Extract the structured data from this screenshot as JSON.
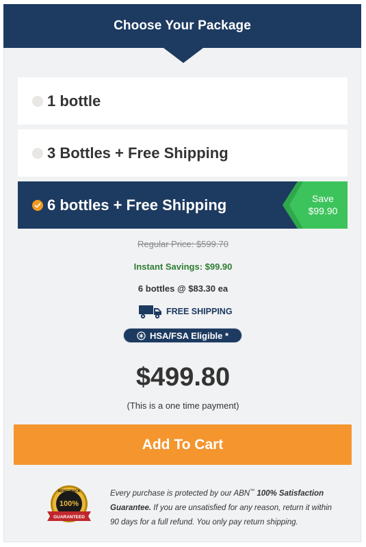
{
  "header": {
    "title": "Choose Your Package"
  },
  "packages": [
    {
      "label": "1 bottle",
      "selected": false
    },
    {
      "label": "3 Bottles + Free Shipping",
      "selected": false
    },
    {
      "label": "6 bottles + Free Shipping",
      "selected": true,
      "save_line1": "Save",
      "save_line2": "$99.90"
    }
  ],
  "details": {
    "regular_price": "Regular Price: $599.70",
    "instant_savings": "Instant Savings: $99.90",
    "per_bottle": "6 bottles @ $83.30 ea",
    "shipping_label": "FREE SHIPPING",
    "hsa_label": "HSA/FSA Eligible *"
  },
  "price": "$499.80",
  "payment_note": "(This is a one time payment)",
  "cart_button": "Add To Cart",
  "guarantee": {
    "text_before": "Every purchase is protected by our ABN",
    "tm": "™",
    "bold": " 100% Satisfaction Guarantee.",
    "text_after": " If you are unsatisfied for any reason, return it within 90 days for a full refund. You only pay return shipping.",
    "seal_top": "MONEYBACK",
    "seal_center": "100%",
    "seal_banner": "GUARANTEED"
  },
  "colors": {
    "navy": "#1d3a60",
    "orange": "#f4952e",
    "green": "#2e7d32",
    "badge_green": "#3cc35c"
  }
}
